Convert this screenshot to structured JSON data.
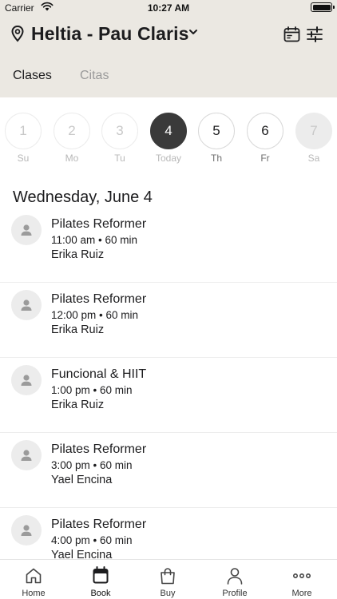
{
  "status_bar": {
    "carrier": "Carrier",
    "time": "10:27 AM"
  },
  "header": {
    "location": "Heltia - Pau Claris"
  },
  "tabs": [
    {
      "label": "Clases",
      "active": true
    },
    {
      "label": "Citas",
      "active": false
    }
  ],
  "days": [
    {
      "num": "1",
      "label": "Su",
      "state": "past"
    },
    {
      "num": "2",
      "label": "Mo",
      "state": "past"
    },
    {
      "num": "3",
      "label": "Tu",
      "state": "past"
    },
    {
      "num": "4",
      "label": "Today",
      "state": "selected"
    },
    {
      "num": "5",
      "label": "Th",
      "state": "normal"
    },
    {
      "num": "6",
      "label": "Fr",
      "state": "normal"
    },
    {
      "num": "7",
      "label": "Sa",
      "state": "disabled"
    }
  ],
  "date_heading": "Wednesday, June 4",
  "classes": [
    {
      "name": "Pilates Reformer",
      "time": "11:00 am • 60 min",
      "instructor": "Erika Ruiz"
    },
    {
      "name": "Pilates Reformer",
      "time": "12:00 pm • 60 min",
      "instructor": "Erika Ruiz"
    },
    {
      "name": "Funcional & HIIT",
      "time": "1:00 pm • 60 min",
      "instructor": "Erika Ruiz"
    },
    {
      "name": "Pilates Reformer",
      "time": "3:00 pm • 60 min",
      "instructor": "Yael Encina"
    },
    {
      "name": "Pilates Reformer",
      "time": "4:00 pm • 60 min",
      "instructor": "Yael Encina"
    }
  ],
  "nav": [
    {
      "label": "Home",
      "icon": "home-icon"
    },
    {
      "label": "Book",
      "icon": "calendar-icon",
      "active": true
    },
    {
      "label": "Buy",
      "icon": "shopping-bag-icon"
    },
    {
      "label": "Profile",
      "icon": "person-icon"
    },
    {
      "label": "More",
      "icon": "more-dots-icon"
    }
  ],
  "colors": {
    "header_bg": "#ebe8e2",
    "selected_day": "#3a3a3a",
    "avatar_bg": "#ececec"
  }
}
